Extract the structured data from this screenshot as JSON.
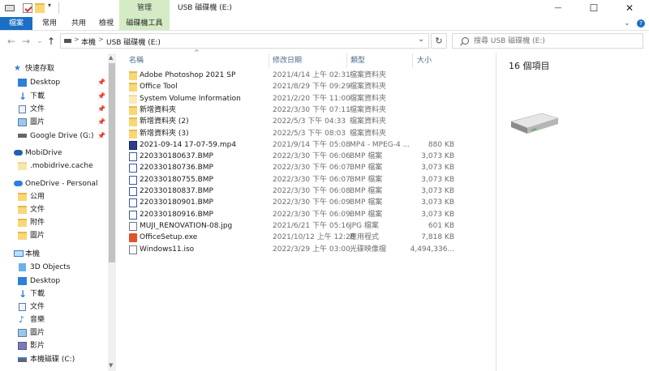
{
  "window": {
    "title": "USB 磁碟機 (E:)",
    "context_tab": "管理",
    "minimize": "—",
    "maximize": "☐",
    "close": "✕"
  },
  "ribbon": {
    "tabs": [
      "檔案",
      "常用",
      "共用",
      "檢視",
      "磁碟機工具"
    ],
    "expand": "⌄",
    "help": "?"
  },
  "address": {
    "back": "←",
    "forward": "→",
    "history": "⌄",
    "up": "↑",
    "separator": ">",
    "breadcrumb": [
      "本機",
      "USB 磁碟機 (E:)"
    ],
    "dropdown": "⌄",
    "refresh": "↻",
    "search_placeholder": "搜尋 USB 磁碟機 (E:)"
  },
  "nav": {
    "quick_access": "快速存取",
    "quick_items": [
      "Desktop",
      "下載",
      "文件",
      "圖片",
      "Google Drive (G:)"
    ],
    "mobidrive": "MobiDrive",
    "mobidrive_items": [
      ".mobidrive.cache"
    ],
    "onedrive": "OneDrive - Personal",
    "onedrive_items": [
      "公用",
      "文件",
      "附件",
      "圖片"
    ],
    "this_pc": "本機",
    "pc_items": [
      "3D Objects",
      "Desktop",
      "下載",
      "文件",
      "音樂",
      "圖片",
      "影片",
      "本機磁碟 (C:)"
    ]
  },
  "columns": {
    "name": "名稱",
    "date": "修改日期",
    "type": "類型",
    "size": "大小",
    "sort_arrow": "^"
  },
  "files": [
    {
      "name": "Adobe Photoshop 2021 SP",
      "date": "2021/4/14 上午 02:31",
      "type": "檔案資料夾",
      "size": "",
      "icon": "folder"
    },
    {
      "name": "Office Tool",
      "date": "2021/8/29 下午 09:29",
      "type": "檔案資料夾",
      "size": "",
      "icon": "folder"
    },
    {
      "name": "System Volume Information",
      "date": "2021/2/20 下午 11:00",
      "type": "檔案資料夾",
      "size": "",
      "icon": "folder-hidden"
    },
    {
      "name": "新增資料夾",
      "date": "2022/3/30 下午 07:11",
      "type": "檔案資料夾",
      "size": "",
      "icon": "folder"
    },
    {
      "name": "新增資料夾 (2)",
      "date": "2022/5/3 下午 04:33",
      "type": "檔案資料夾",
      "size": "",
      "icon": "folder"
    },
    {
      "name": "新增資料夾 (3)",
      "date": "2022/5/3 下午 08:03",
      "type": "檔案資料夾",
      "size": "",
      "icon": "folder"
    },
    {
      "name": "2021-09-14 17-07-59.mp4",
      "date": "2021/9/14 下午 05:08",
      "type": "MP4 - MPEG-4 ...",
      "size": "880 KB",
      "icon": "video"
    },
    {
      "name": "220330180637.BMP",
      "date": "2022/3/30 下午 06:06",
      "type": "BMP 檔案",
      "size": "3,073 KB",
      "icon": "bmp"
    },
    {
      "name": "220330180736.BMP",
      "date": "2022/3/30 下午 06:07",
      "type": "BMP 檔案",
      "size": "3,073 KB",
      "icon": "bmp"
    },
    {
      "name": "220330180755.BMP",
      "date": "2022/3/30 下午 06:07",
      "type": "BMP 檔案",
      "size": "3,073 KB",
      "icon": "bmp"
    },
    {
      "name": "220330180837.BMP",
      "date": "2022/3/30 下午 06:08",
      "type": "BMP 檔案",
      "size": "3,073 KB",
      "icon": "bmp"
    },
    {
      "name": "220330180901.BMP",
      "date": "2022/3/30 下午 06:09",
      "type": "BMP 檔案",
      "size": "3,073 KB",
      "icon": "bmp"
    },
    {
      "name": "220330180916.BMP",
      "date": "2022/3/30 下午 06:09",
      "type": "BMP 檔案",
      "size": "3,073 KB",
      "icon": "bmp"
    },
    {
      "name": "MUJI_RENOVATION-08.jpg",
      "date": "2021/6/21 下午 05:16",
      "type": "JPG 檔案",
      "size": "601 KB",
      "icon": "image"
    },
    {
      "name": "OfficeSetup.exe",
      "date": "2021/10/12 上午 12:28",
      "type": "應用程式",
      "size": "7,818 KB",
      "icon": "office"
    },
    {
      "name": "Windows11.iso",
      "date": "2022/3/29 上午 03:00",
      "type": "光碟映像檔",
      "size": "4,494,336...",
      "icon": "disc"
    }
  ],
  "preview": {
    "item_count": "16 個項目",
    "icon": "usb-drive-icon"
  },
  "colors": {
    "file_tab": "#1a6fc4",
    "context_tab": "#d4ebc5",
    "folder": "#f8d775",
    "header_text": "#4a6a8a"
  }
}
